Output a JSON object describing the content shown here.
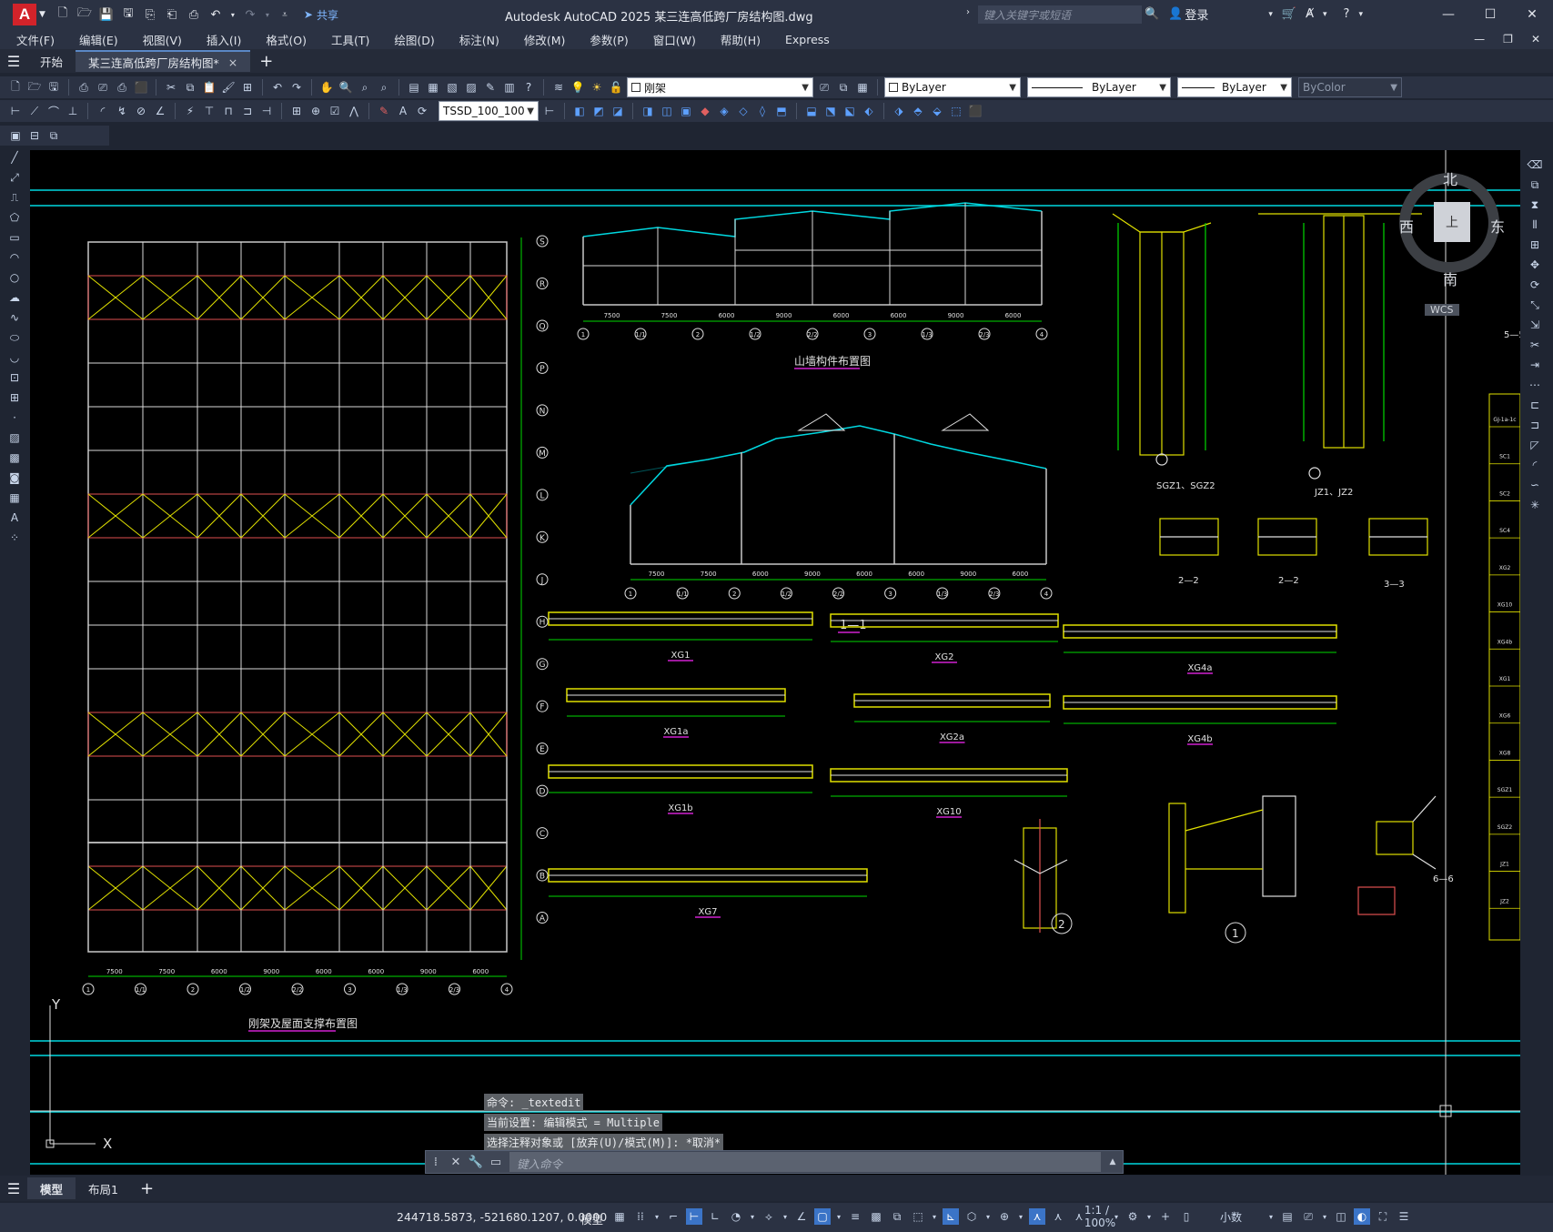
{
  "app": {
    "title": "Autodesk AutoCAD 2025    某三连高低跨厂房结构图.dwg",
    "logo": "A",
    "share_label": "共享",
    "search_placeholder": "键入关键字或短语",
    "login_label": "登录"
  },
  "menu": [
    "文件(F)",
    "编辑(E)",
    "视图(V)",
    "插入(I)",
    "格式(O)",
    "工具(T)",
    "绘图(D)",
    "标注(N)",
    "修改(M)",
    "参数(P)",
    "窗口(W)",
    "帮助(H)",
    "Express"
  ],
  "doc_tabs": [
    {
      "label": "开始"
    },
    {
      "label": "某三连高低跨厂房结构图*",
      "close": "×"
    }
  ],
  "toolbar": {
    "layer_name": "刚架",
    "color": "ByLayer",
    "linetype": "ByLayer",
    "lineweight": "ByLayer",
    "plotstyle": "ByColor",
    "textstyle": "TSSD_100_100"
  },
  "viewcube": {
    "north": "北",
    "south": "南",
    "west": "西",
    "east": "东",
    "face": "上",
    "wcs": "WCS"
  },
  "drawing": {
    "plan_title": "刚架及屋面支撑布置图",
    "elev_title": "山墙构件布置图",
    "section_title": "1—1",
    "col_titles": [
      "SGZ1、SGZ2",
      "JZ1、JZ2",
      "5—5"
    ],
    "sec_22a": "2—2",
    "sec_22b": "2—2",
    "sec_33": "3—3",
    "sec_66": "6—6",
    "beams": [
      "XG1",
      "XG1a",
      "XG1b",
      "XG7",
      "XG2",
      "XG2a",
      "XG10",
      "XG4a",
      "XG4b"
    ],
    "axis_letters": [
      "S",
      "R",
      "Q",
      "P",
      "N",
      "M",
      "L",
      "K",
      "J",
      "H",
      "G",
      "F",
      "E",
      "D",
      "C",
      "B",
      "A"
    ],
    "axis_numbers": [
      "1",
      "1/1",
      "2",
      "1/2",
      "2/2",
      "3",
      "1/3",
      "2/3",
      "4"
    ],
    "plan_dims": [
      "7500",
      "7500",
      "6000",
      "9000",
      "6000",
      "6000",
      "9000",
      "6000"
    ],
    "elev_dims": [
      "7500",
      "7500",
      "6000",
      "9000",
      "6000",
      "6000",
      "9000",
      "6000"
    ],
    "node1": "1",
    "node2": "2",
    "ucs_y": "Y",
    "ucs_x": "X",
    "legend_items": [
      "GJ-1a-1c",
      "SC1",
      "SC2",
      "SC4",
      "XG2",
      "XG10",
      "XG4b",
      "XG1",
      "XG6",
      "XG8",
      "SGZ1",
      "SGZ2",
      "JZ1",
      "JZ2"
    ]
  },
  "command": {
    "history": [
      "命令: _textedit",
      "当前设置: 编辑模式 = Multiple",
      "选择注释对象或 [放弃(U)/模式(M)]: *取消*"
    ],
    "placeholder": "键入命令"
  },
  "layout_tabs": [
    "模型",
    "布局1"
  ],
  "status": {
    "coords": "244718.5873, -521680.1207, 0.0000",
    "model": "模型",
    "scale": "1:1 / 100%",
    "units": "小数"
  }
}
